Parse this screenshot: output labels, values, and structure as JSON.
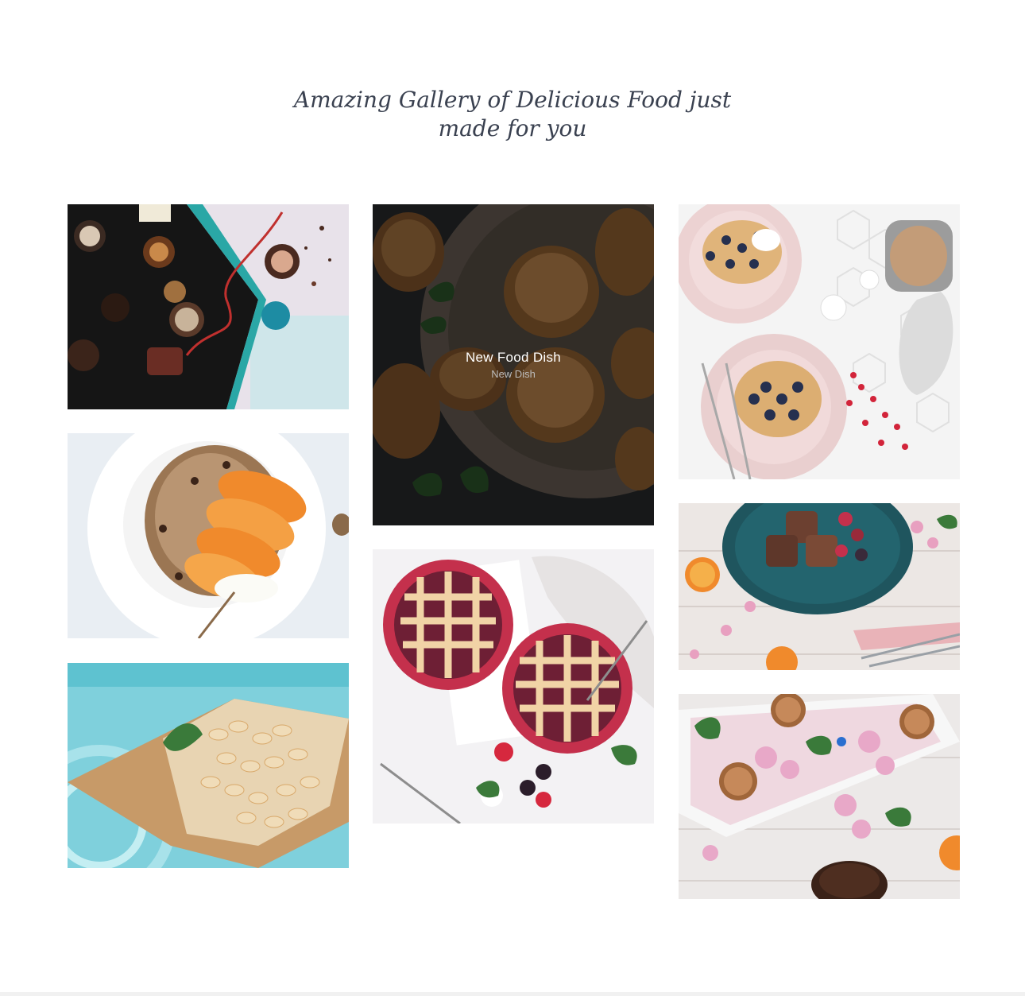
{
  "section": {
    "title_line1": "Amazing Gallery of Delicious Food just",
    "title_line2": "made for you"
  },
  "gallery": {
    "items": [
      {
        "image": "chocolate-box-photo"
      },
      {
        "image": "muesli-peach-bowl-photo"
      },
      {
        "image": "puffed-rice-cone-photo"
      },
      {
        "image": "bread-rolls-basket-photo",
        "overlay_title": "New Food Dish",
        "overlay_subtitle": "New Dish"
      },
      {
        "image": "berry-lattice-pies-photo"
      },
      {
        "image": "blueberry-waffles-photo"
      },
      {
        "image": "french-toast-teal-plate-photo"
      },
      {
        "image": "energy-balls-flowers-tray-photo"
      }
    ]
  },
  "colors": {
    "heading": "#3a4150",
    "overlay_title": "#ffffff",
    "overlay_subtitle": "#bdbdbd"
  }
}
